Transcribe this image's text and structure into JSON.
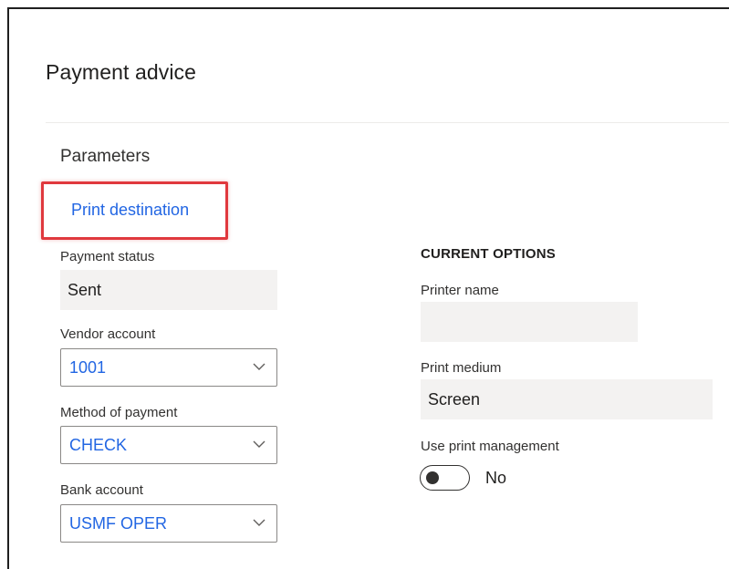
{
  "page": {
    "title": "Payment advice"
  },
  "parameters": {
    "heading": "Parameters",
    "print_destination": "Print destination",
    "payment_status": {
      "label": "Payment status",
      "value": "Sent"
    },
    "vendor_account": {
      "label": "Vendor account",
      "value": "1001"
    },
    "method_of_payment": {
      "label": "Method of payment",
      "value": "CHECK"
    },
    "bank_account": {
      "label": "Bank account",
      "value": "USMF OPER"
    }
  },
  "current_options": {
    "heading": "CURRENT OPTIONS",
    "printer_name": {
      "label": "Printer name",
      "value": ""
    },
    "print_medium": {
      "label": "Print medium",
      "value": "Screen"
    },
    "use_print_management": {
      "label": "Use print management",
      "value": "No",
      "on": false
    }
  },
  "colors": {
    "accent": "#2266e3",
    "highlight": "#e0393e",
    "field_bg": "#f3f2f1"
  },
  "icons": {
    "dropdown": "chevron-down-icon"
  }
}
